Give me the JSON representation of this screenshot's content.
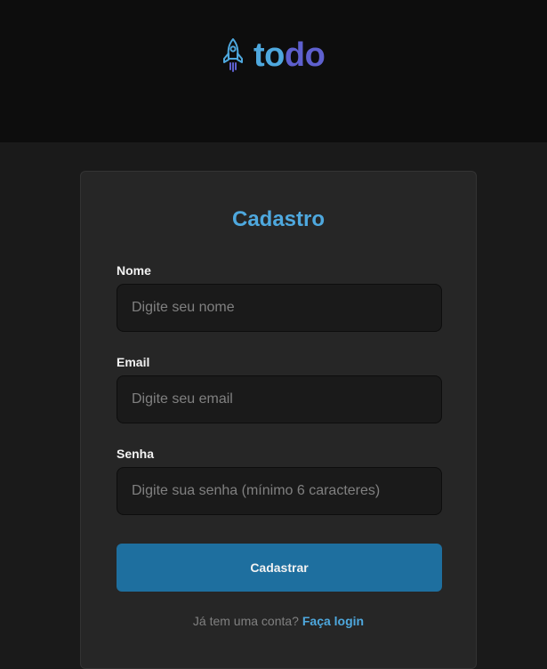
{
  "header": {
    "logo_icon": "rocket-icon",
    "logo_text_part1": "to",
    "logo_text_part2": "do",
    "colors": {
      "primary": "#4ea8de",
      "secondary": "#5e60ce"
    }
  },
  "form": {
    "title": "Cadastro",
    "fields": [
      {
        "label": "Nome",
        "placeholder": "Digite seu nome",
        "value": ""
      },
      {
        "label": "Email",
        "placeholder": "Digite seu email",
        "value": ""
      },
      {
        "label": "Senha",
        "placeholder": "Digite sua senha (mínimo 6 caracteres)",
        "value": ""
      }
    ],
    "submit_label": "Cadastrar",
    "footer_text": "Já tem uma conta?",
    "footer_link": "Faça login",
    "colors": {
      "accent": "#4ea8de",
      "button": "#1e6f9f"
    }
  }
}
